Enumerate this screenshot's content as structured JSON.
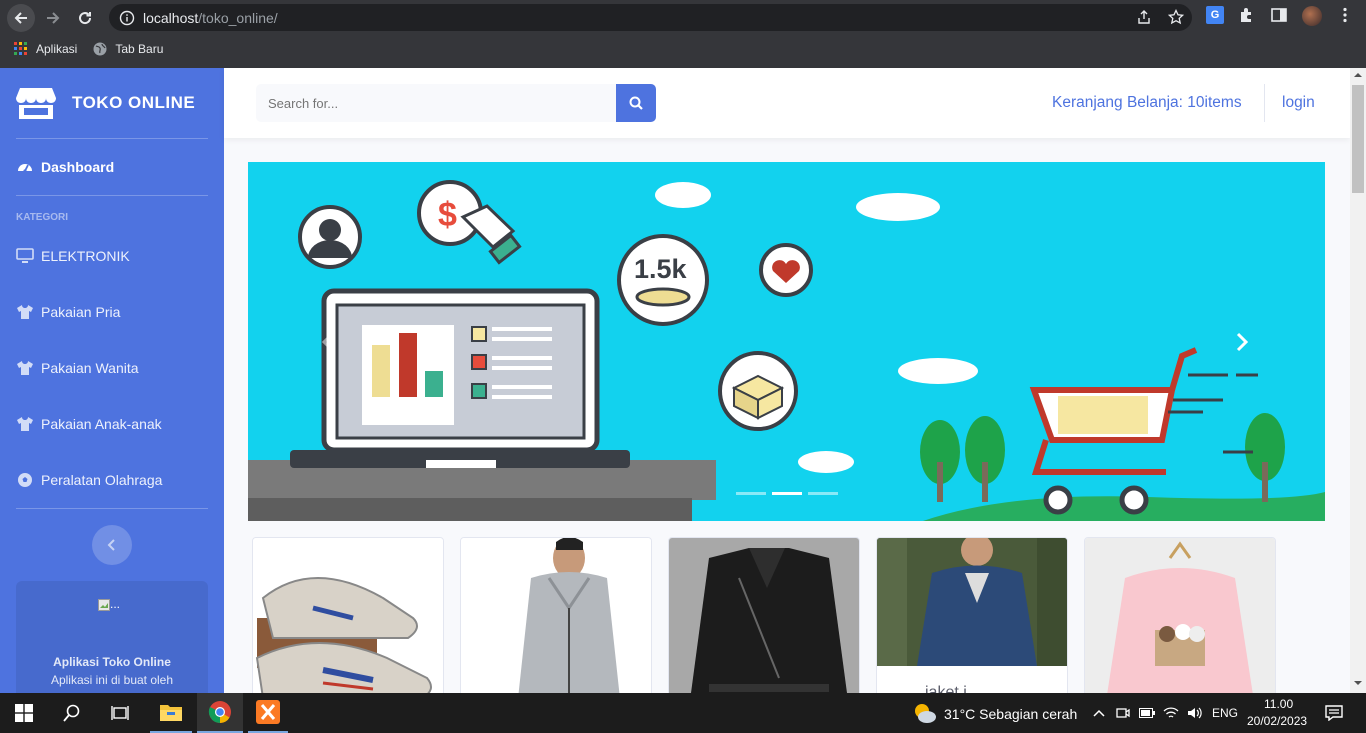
{
  "browser": {
    "url_host": "localhost",
    "url_path": "/toko_online/",
    "bookmarks": [
      {
        "label": "Aplikasi",
        "icon": "apps-grid-icon"
      },
      {
        "label": "Tab Baru",
        "icon": "globe-icon"
      }
    ]
  },
  "sidebar": {
    "brand": "TOKO ONLINE",
    "dashboard": "Dashboard",
    "heading": "KATEGORI",
    "items": [
      {
        "label": "ELEKTRONIK",
        "icon": "desktop-icon"
      },
      {
        "label": "Pakaian Pria",
        "icon": "tshirt-icon"
      },
      {
        "label": "Pakaian Wanita",
        "icon": "tshirt-icon"
      },
      {
        "label": "Pakaian Anak-anak",
        "icon": "tshirt-icon"
      },
      {
        "label": "Peralatan Olahraga",
        "icon": "football-icon"
      }
    ],
    "card_broken_alt": "...",
    "card_title": "Aplikasi Toko Online",
    "card_text": "Aplikasi ini di buat oleh"
  },
  "topbar": {
    "search_placeholder": "Search for...",
    "cart": "Keranjang Belanja: 10items",
    "login": "login"
  },
  "carousel": {
    "slides": 3,
    "active": 1,
    "banner_text": "1.5k"
  },
  "products": [
    {
      "name": "",
      "image": "sneakers"
    },
    {
      "name": "",
      "image": "grey-hoodie"
    },
    {
      "name": "",
      "image": "leather-jacket"
    },
    {
      "name": "jaket j...",
      "image": "denim-jacket"
    },
    {
      "name": "",
      "image": "pink-hoodie"
    }
  ],
  "taskbar": {
    "weather": "31°C  Sebagian cerah",
    "lang": "ENG",
    "time": "11.00",
    "date": "20/02/2023"
  },
  "colors": {
    "primary": "#4e73df",
    "banner": "#12d2ee",
    "chrome_dark": "#35363a"
  }
}
